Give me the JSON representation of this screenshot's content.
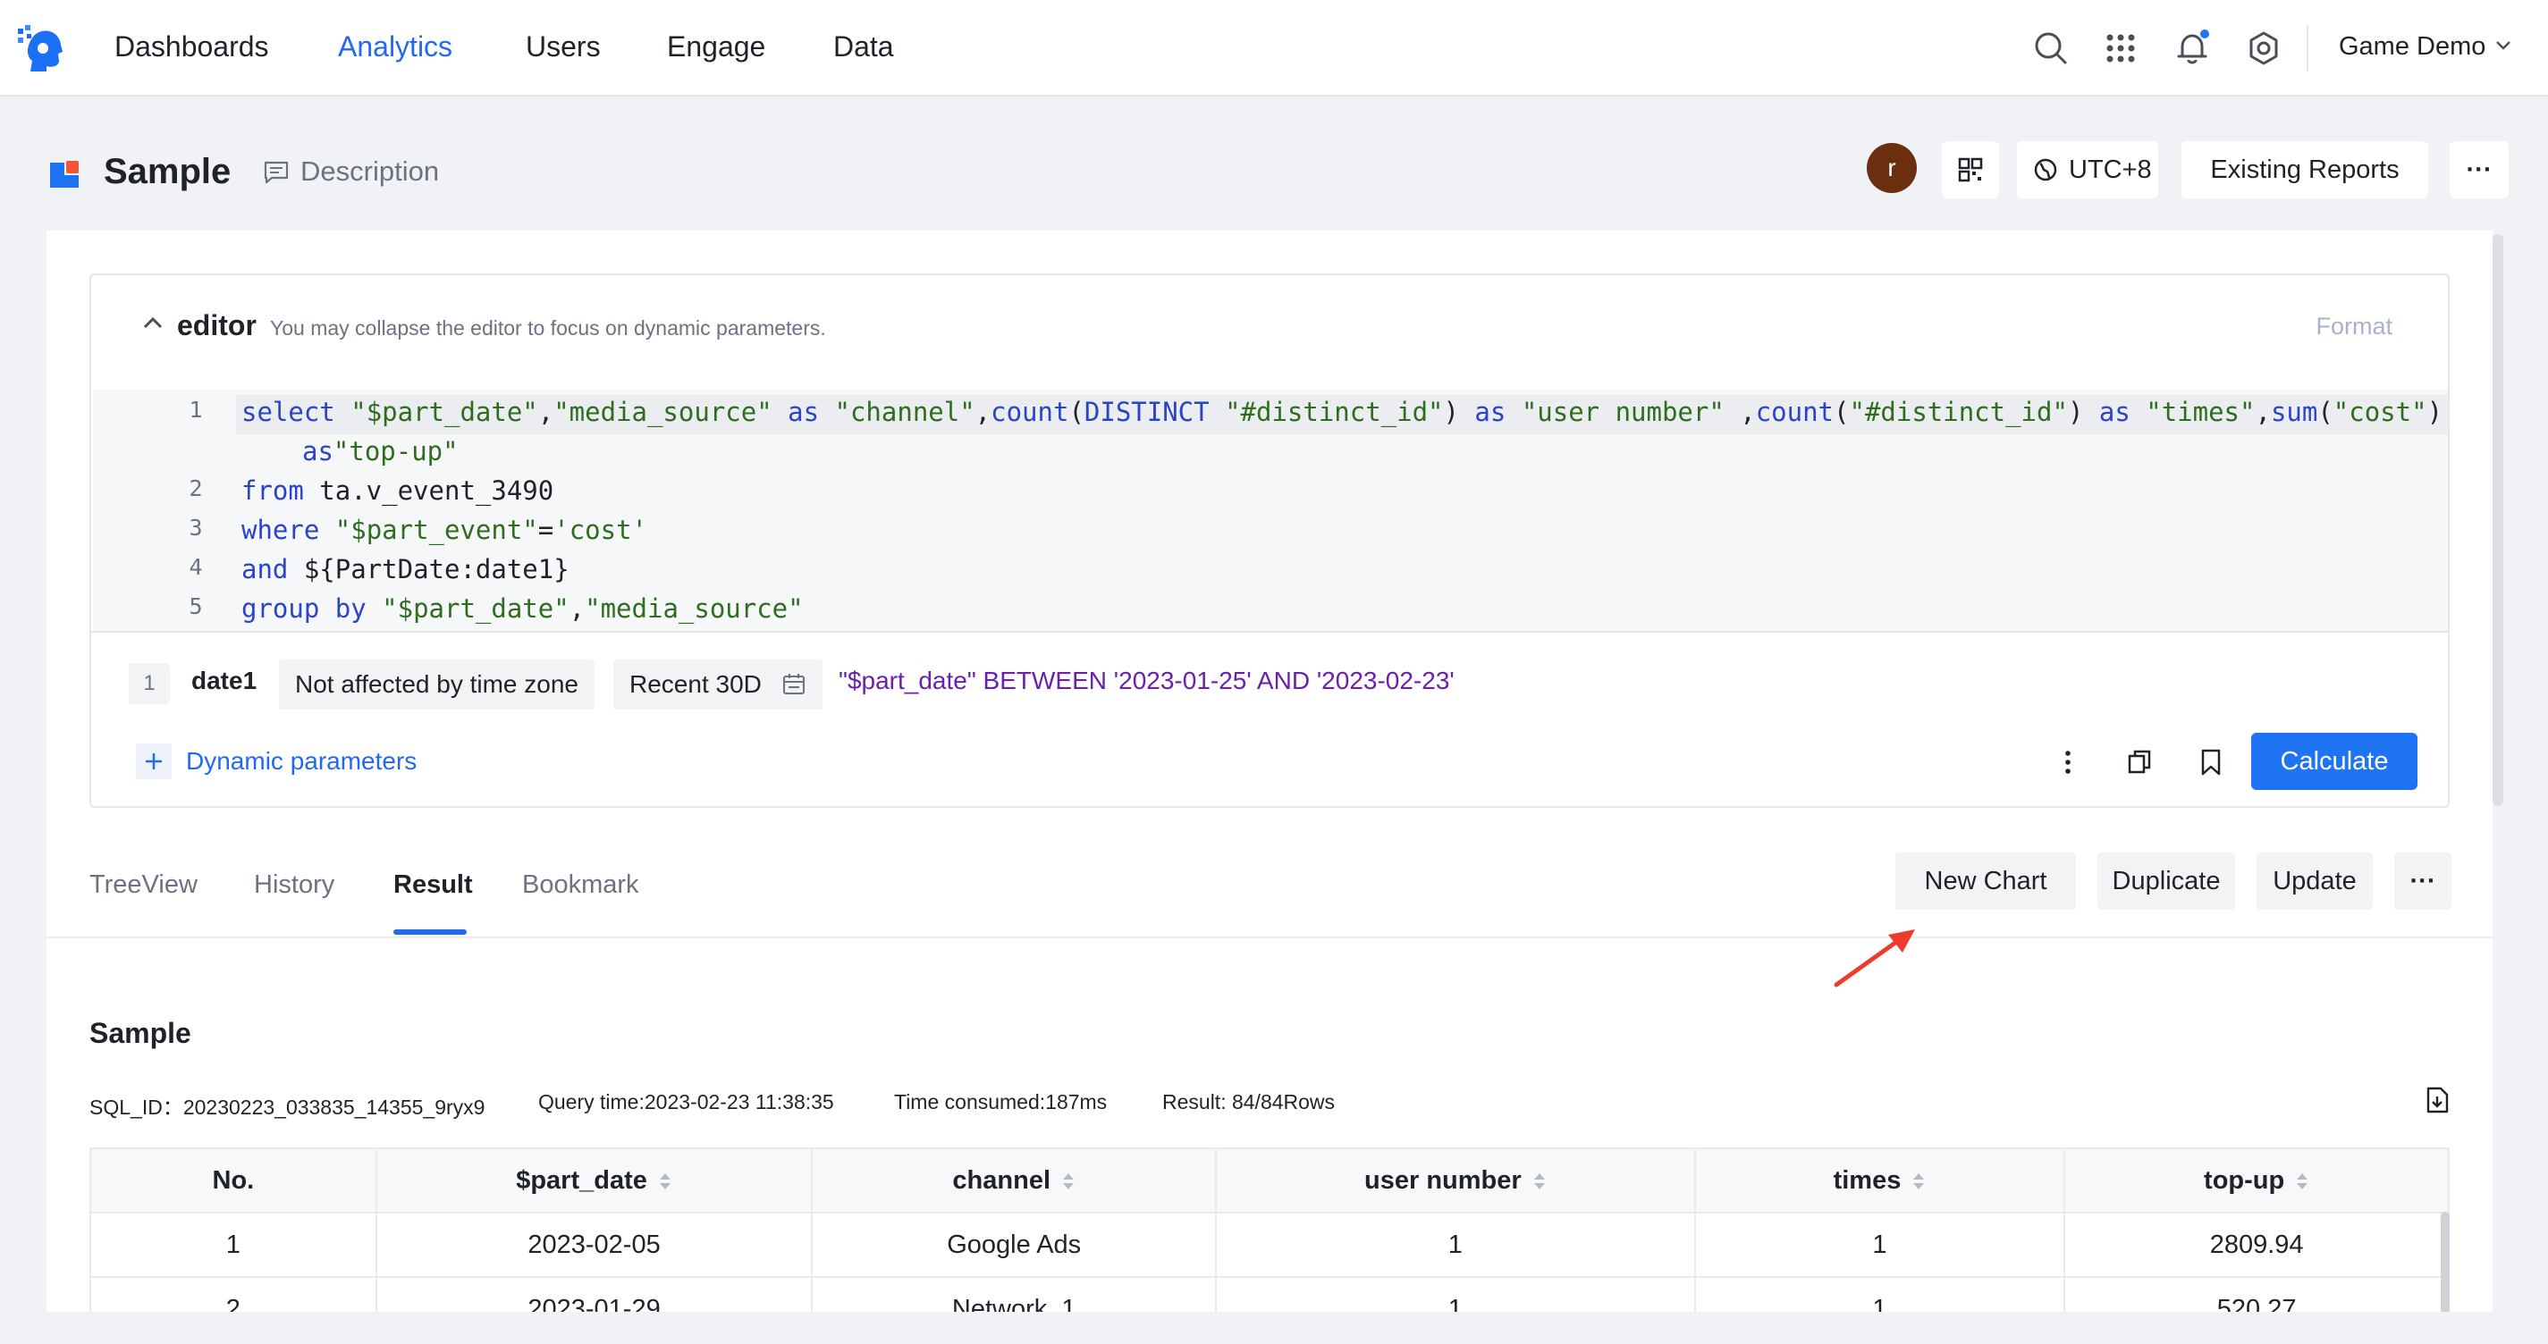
{
  "nav": {
    "items": [
      {
        "label": "Dashboards",
        "active": false
      },
      {
        "label": "Analytics",
        "active": true
      },
      {
        "label": "Users",
        "active": false
      },
      {
        "label": "Engage",
        "active": false
      },
      {
        "label": "Data",
        "active": false
      }
    ],
    "icons": [
      "search-icon",
      "apps-grid-icon",
      "bell-icon",
      "gear-icon"
    ],
    "project": "Game Demo",
    "accent": "#2468f2"
  },
  "header": {
    "title": "Sample",
    "description": "Description",
    "avatar_letter": "r",
    "timezone": "UTC+8",
    "existing_reports": "Existing Reports",
    "more": "···"
  },
  "editor": {
    "label": "editor",
    "hint": "You may collapse the editor to focus on dynamic parameters.",
    "format": "Format",
    "lines": [
      {
        "n": "1"
      },
      {
        "n": "2",
        "text": "from ta.v_event_3490"
      },
      {
        "n": "3"
      },
      {
        "n": "4",
        "text": "and ${PartDate:date1}"
      },
      {
        "n": "5"
      }
    ]
  },
  "params": {
    "index": "1",
    "name": "date1",
    "timezone_mode": "Not affected by time zone",
    "range": "Recent 30D",
    "sql": "\"$part_date\" BETWEEN '2023-01-25' AND '2023-02-23'",
    "add_label": "Dynamic parameters",
    "calculate": "Calculate"
  },
  "tabs": [
    {
      "label": "TreeView",
      "active": false
    },
    {
      "label": "History",
      "active": false
    },
    {
      "label": "Result",
      "active": true
    },
    {
      "label": "Bookmark",
      "active": false
    }
  ],
  "actions": {
    "new_chart": "New Chart",
    "duplicate": "Duplicate",
    "update": "Update",
    "more": "···"
  },
  "result": {
    "title": "Sample",
    "sql_id": "SQL_ID：20230223_033835_14355_9ryx9",
    "query_time": "Query time:2023-02-23 11:38:35",
    "time_consumed": "Time consumed:187ms",
    "rows": "Result: 84/84Rows",
    "columns": [
      "No.",
      "$part_date",
      "channel",
      "user number",
      "times",
      "top-up"
    ],
    "data": [
      [
        "1",
        "2023-02-05",
        "Google Ads",
        "1",
        "1",
        "2809.94"
      ],
      [
        "2",
        "2023-01-29",
        "Network_1",
        "1",
        "1",
        "520.27"
      ]
    ]
  }
}
